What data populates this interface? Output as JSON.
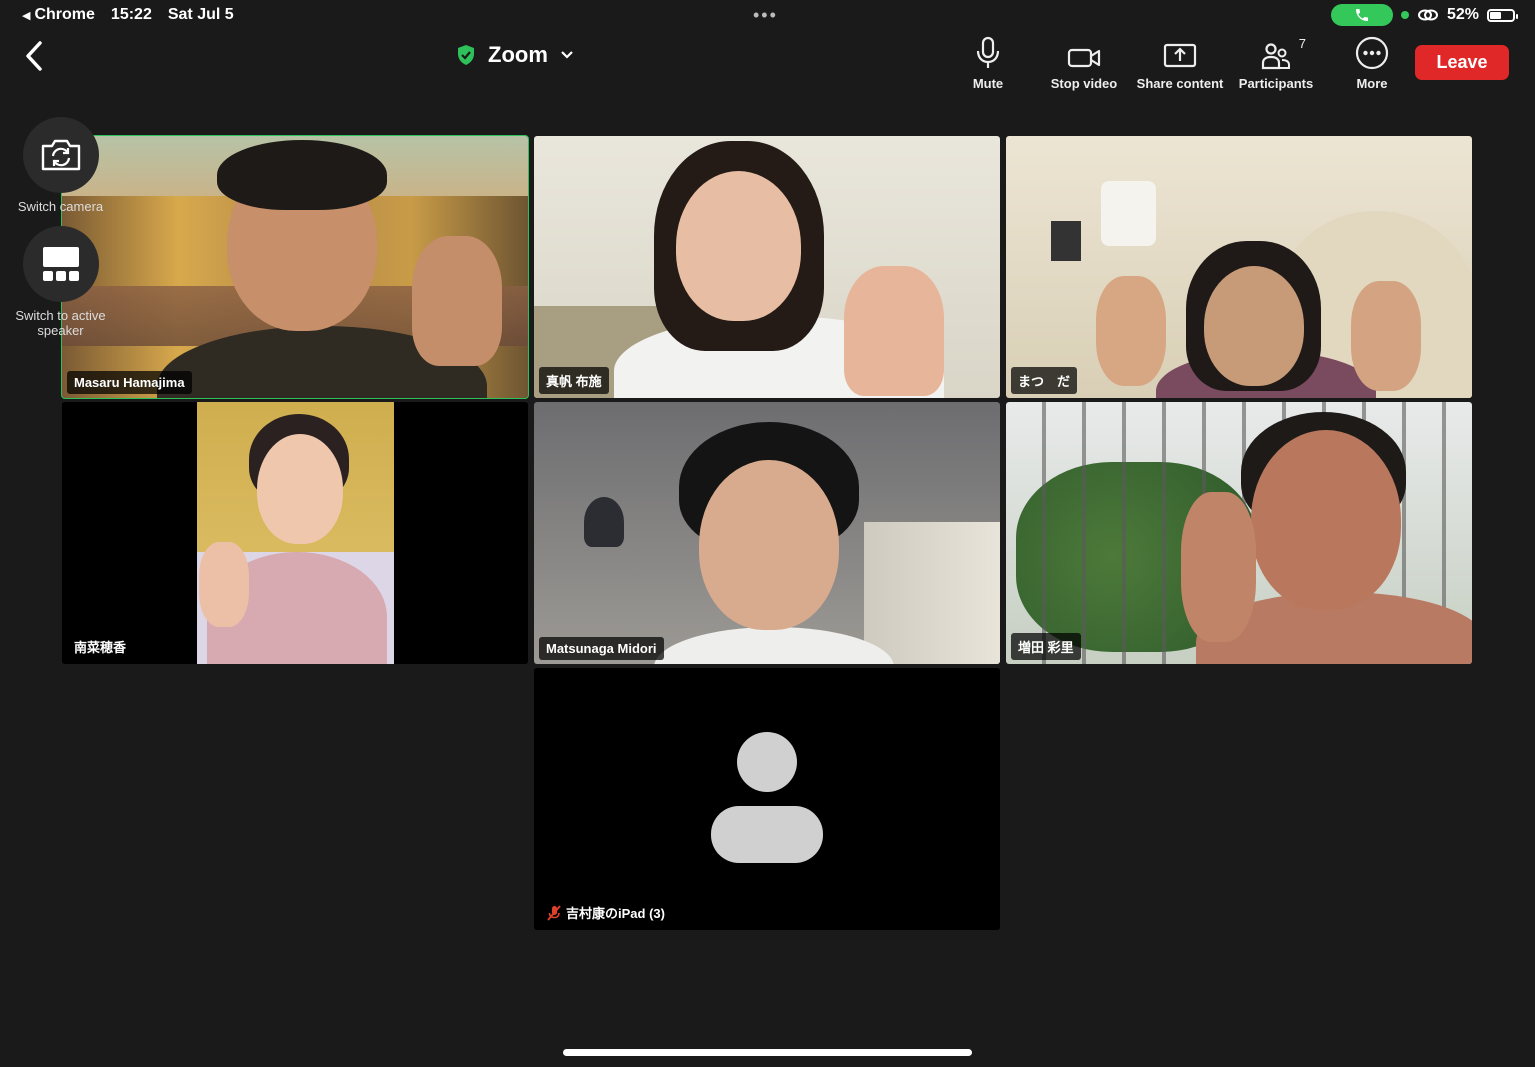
{
  "status_bar": {
    "back_app": "Chrome",
    "time": "15:22",
    "date": "Sat Jul 5",
    "battery": "52%",
    "battery_level": 0.52
  },
  "meeting": {
    "title": "Zoom"
  },
  "toolbar": {
    "mute": "Mute",
    "stop_video": "Stop video",
    "share_content": "Share content",
    "participants": "Participants",
    "participants_count": "7",
    "more": "More",
    "leave": "Leave"
  },
  "side": {
    "switch_camera": "Switch camera",
    "switch_active_speaker": "Switch to active speaker"
  },
  "participants": [
    {
      "name": "Masaru Hamajima"
    },
    {
      "name": "真帆 布施"
    },
    {
      "name": "まつ　だ"
    },
    {
      "name": "南菜穂香"
    },
    {
      "name": "Matsunaga Midori"
    },
    {
      "name": "増田 彩里"
    },
    {
      "name": "吉村康のiPad (3)"
    }
  ],
  "colors": {
    "leave": "#e02828",
    "active_speaker_border": "#2ec05a",
    "call_pill": "#34c759",
    "muted_icon": "#e0402a"
  }
}
